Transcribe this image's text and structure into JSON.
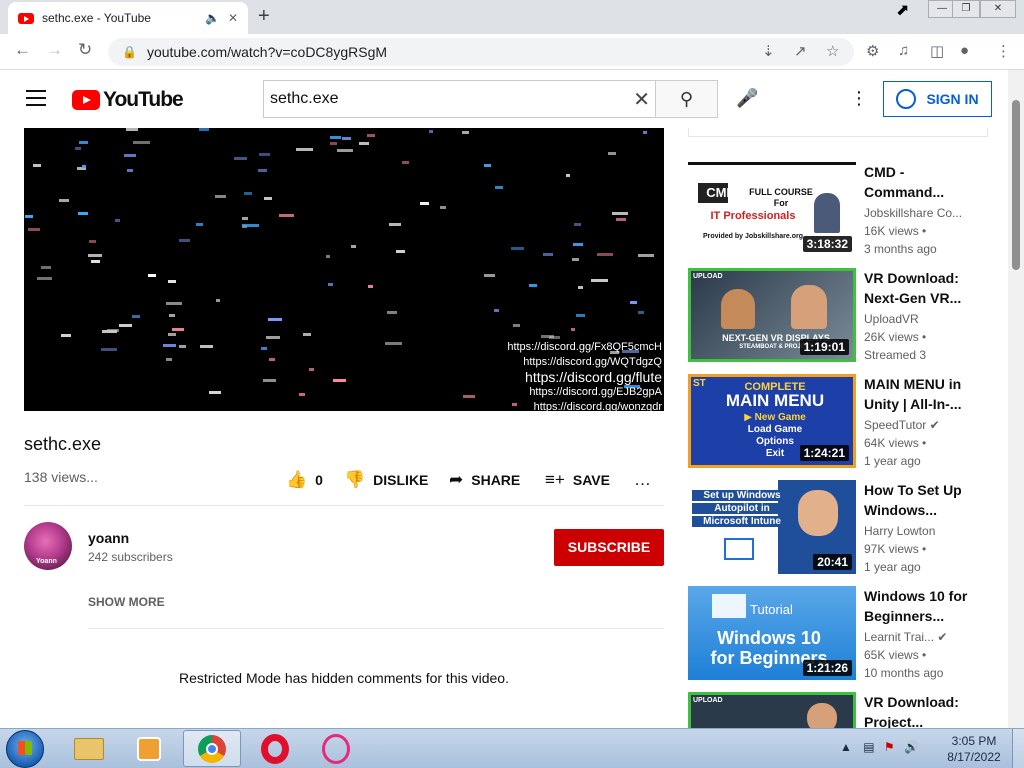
{
  "browser": {
    "tab_title": "sethc.exe - YouTube",
    "new_tab_icon": "plus-icon",
    "url": "youtube.com/watch?v=coDC8ygRSgM"
  },
  "youtube": {
    "logo_text": "YouTube",
    "search_value": "sethc.exe",
    "sign_in": "SIGN IN"
  },
  "video": {
    "overlay_lines": [
      "https://discord.gg/Fx8QF5cmcH",
      "https://discord.gg/WQTdgzQ",
      "https://discord.gg/flute",
      "https://discord.gg/EJB2gpA",
      "https://discord.gg/wonzgdr"
    ],
    "title": "sethc.exe",
    "views": "138 views...",
    "like_count": "0",
    "dislike": "DISLIKE",
    "share": "SHARE",
    "save": "SAVE"
  },
  "channel": {
    "name": "yoann",
    "avatar_text": "Yoann",
    "subscribers": "242 subscribers",
    "subscribe": "SUBSCRIBE",
    "show_more": "SHOW MORE"
  },
  "comments_notice": "Restricted Mode has hidden comments for this video.",
  "recommendations": [
    {
      "title1": "CMD -",
      "title2": "Command...",
      "channel": "Jobskillshare Co...",
      "views": "16K views •",
      "age": "3 months ago",
      "duration": "3:18:32",
      "thumb_lines": [
        "CMD",
        "FULL COURSE",
        "For",
        "IT Professionals",
        "Provided by Jobskillshare.org"
      ]
    },
    {
      "title1": "VR Download:",
      "title2": "Next-Gen VR...",
      "channel": "UploadVR",
      "views": "26K views •",
      "age": "Streamed 3",
      "duration": "1:19:01",
      "thumb_lines": [
        "UPLOAD",
        "NEXT-GEN VR DISPLAYS",
        "STEAMBOAT & PROJECT"
      ]
    },
    {
      "title1": "MAIN MENU in",
      "title2": "Unity | All-In-...",
      "channel": "SpeedTutor",
      "views": "64K views •",
      "age": "1 year ago",
      "duration": "1:24:21",
      "thumb_lines": [
        "ST",
        "COMPLETE",
        "MAIN MENU",
        "▶ New Game",
        "Load Game",
        "Options",
        "Exit"
      ]
    },
    {
      "title1": "How To Set Up",
      "title2": "Windows...",
      "channel": "Harry Lowton",
      "views": "97K views •",
      "age": "1 year ago",
      "duration": "20:41",
      "thumb_lines": [
        "Set up Windows",
        "Autopilot in",
        "Microsoft Intune"
      ]
    },
    {
      "title1": "Windows 10 for",
      "title2": "Beginners...",
      "channel": "Learnit Trai...",
      "views": "65K views •",
      "age": "10 months ago",
      "duration": "1:21:26",
      "thumb_lines": [
        "Tutorial",
        "Windows 10",
        "for Beginners"
      ]
    },
    {
      "title1": "VR Download:",
      "title2": "Project...",
      "channel": "",
      "views": "",
      "age": "",
      "duration": "",
      "thumb_lines": [
        "UPLOAD"
      ]
    }
  ],
  "taskbar": {
    "time": "3:05 PM",
    "date": "8/17/2022"
  },
  "colors": {
    "youtube_red": "#ff0000",
    "subscribe_red": "#cc0000",
    "link_blue": "#065fd4"
  }
}
